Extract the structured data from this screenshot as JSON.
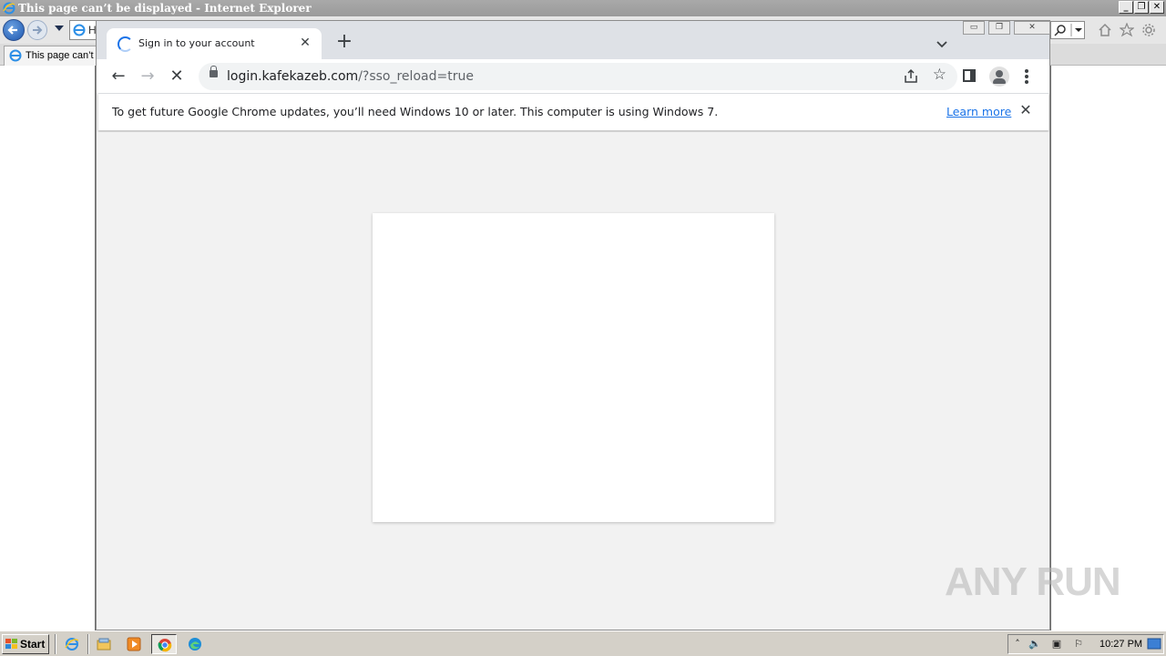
{
  "ie": {
    "window_title": "This page can’t be displayed - Internet Explorer",
    "address_fragment": "H",
    "tab_label": "This page can’t b",
    "icon_name": "internet-explorer-icon",
    "window_controls": {
      "minimize": "_",
      "restore": "❐",
      "close": "✕"
    }
  },
  "chrome": {
    "tab": {
      "title": "Sign in to your account",
      "close": "✕",
      "state_icon": "loading-spinner-icon"
    },
    "new_tab": "+",
    "tab_search": "⌄",
    "window_controls": {
      "minimize": "▭",
      "restore": "❐",
      "close": "✕"
    },
    "toolbar": {
      "back": "←",
      "forward": "→",
      "stop": "✕",
      "url_host": "login.kafekazeb.com",
      "url_path": "/?sso_reload=true"
    },
    "infobar": {
      "message": "To get future Google Chrome updates, you’ll need Windows 10 or later. This computer is using Windows 7.",
      "link": "Learn more",
      "close": "✕"
    }
  },
  "watermark": {
    "text": "ANY RUN"
  },
  "taskbar": {
    "start_label": "Start",
    "apps": [
      "internet-explorer-icon",
      "file-explorer-icon",
      "media-player-icon",
      "chrome-icon",
      "edge-icon"
    ],
    "tray": {
      "show_hidden": "˄",
      "volume": "🔈",
      "network": "▣",
      "flag": "⚐"
    },
    "clock": "10:27 PM"
  },
  "colors": {
    "chrome_tabstrip": "#dee1e6",
    "link_blue": "#1a73e8",
    "content_bg": "#f2f2f2",
    "taskbar": "#d4d0c8"
  }
}
